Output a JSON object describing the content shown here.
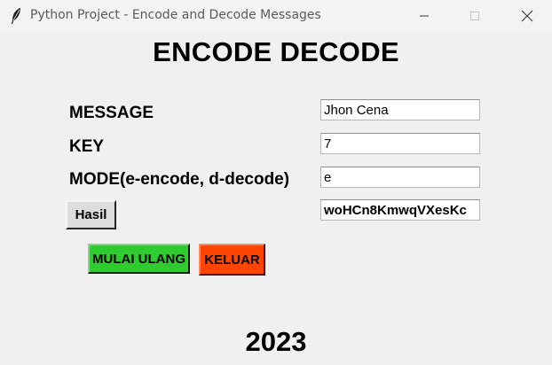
{
  "window": {
    "title": "Python Project - Encode and Decode Messages",
    "icon": "feather-icon"
  },
  "heading": "ENCODE DECODE",
  "form": {
    "message_label": "MESSAGE",
    "message_value": "Jhon Cena",
    "key_label": "KEY",
    "key_value": "7",
    "mode_label": "MODE(e-encode, d-decode)",
    "mode_value": "e",
    "result_value": "woHCn8KmwqVXesKc"
  },
  "buttons": {
    "hasil": "Hasil",
    "restart": "MULAI ULANG",
    "exit": "KELUAR"
  },
  "colors": {
    "restart_bg": "#2ecc2e",
    "exit_bg": "#ff4500"
  },
  "footer": {
    "year": "2023"
  }
}
